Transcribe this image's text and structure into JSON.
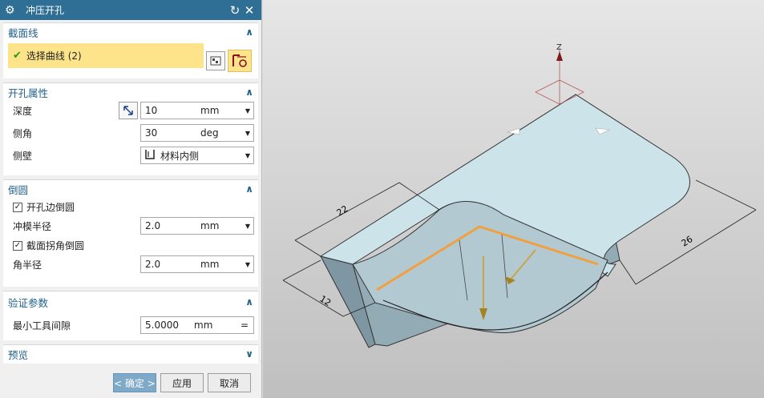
{
  "dialog": {
    "title": "冲压开孔",
    "reset_icon": "reset-icon",
    "close_icon": "close-icon",
    "settings_icon": "gear-icon"
  },
  "section_curve": {
    "title": "截面线",
    "select_label": "选择曲线 (2)"
  },
  "section_props": {
    "title": "开孔属性",
    "depth": {
      "label": "深度",
      "value": "10",
      "unit": "mm"
    },
    "angle": {
      "label": "侧角",
      "value": "30",
      "unit": "deg"
    },
    "sidewall": {
      "label": "侧壁",
      "value": "材料内侧"
    }
  },
  "section_round": {
    "title": "倒圆",
    "hole_edge_round": {
      "label": "开孔边倒圆",
      "checked": true
    },
    "die_radius": {
      "label": "冲模半径",
      "value": "2.0",
      "unit": "mm"
    },
    "corner_round": {
      "label": "截面拐角倒圆",
      "checked": true
    },
    "corner_radius": {
      "label": "角半径",
      "value": "2.0",
      "unit": "mm"
    }
  },
  "section_verify": {
    "title": "验证参数",
    "min_tool_gap": {
      "label": "最小工具间隙",
      "value": "5.0000",
      "unit": "mm",
      "sign": "="
    }
  },
  "section_preview": {
    "title": "预览"
  },
  "footer": {
    "ok": "< 确定 >",
    "apply": "应用",
    "cancel": "取消"
  },
  "viewport": {
    "axis_label": "Z",
    "dim_22": "22",
    "dim_12": "12",
    "dim_26": "26"
  },
  "colors": {
    "title_bar": "#2f6f96",
    "section_title": "#1f5f8b",
    "selection_highlight": "#fde38a",
    "ok_button": "#7fa9c9",
    "part_face": "#cde3ea",
    "hole_curve": "#f0a040"
  }
}
